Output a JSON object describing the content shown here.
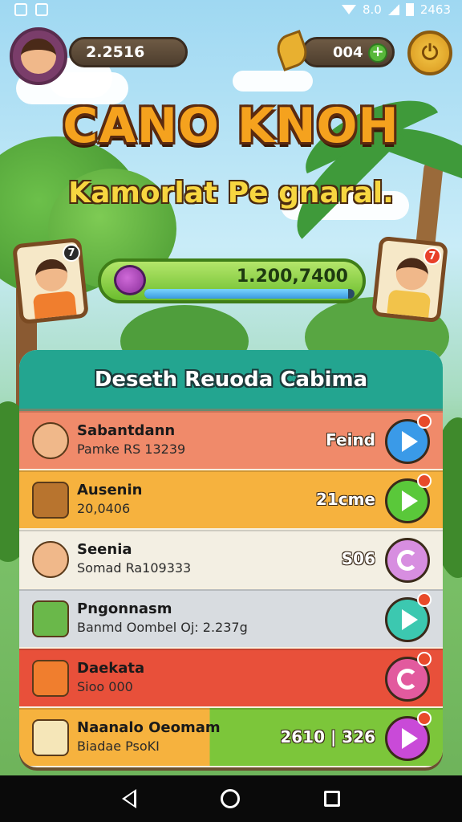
{
  "status_bar": {
    "time": "2463",
    "signal_text": "8.0",
    "icons": [
      "screenshot-icon",
      "gallery-icon",
      "wifi-icon",
      "signal-icon",
      "battery-icon"
    ]
  },
  "header": {
    "coins": "2.2516",
    "gems": "004",
    "plus": "+",
    "power_symbol": "⏻"
  },
  "title": "CANO KNOH",
  "subtitle": "Kamorlat Pe gnaral.",
  "characters": {
    "left_badge": "7",
    "right_badge": "7"
  },
  "xp": {
    "value_text": "1.200,7400",
    "progress": 0.97
  },
  "panel": {
    "title": "Deseth Reuoda Cabima",
    "rows": [
      {
        "name": "Sabantdann",
        "sub": "Pamke RS 13239",
        "right": "Feind",
        "color": "#f08a6a",
        "btn_color": "#3a9ae8",
        "btn": "play"
      },
      {
        "name": "Ausenin",
        "sub": "20,0406",
        "right": "21cme",
        "color": "#f6b23e",
        "btn_color": "#5ac83a",
        "btn": "play"
      },
      {
        "name": "Seenia",
        "sub": "Somad Ra109333",
        "right": "S06",
        "color": "#f3efe3",
        "btn_color": "#d78ee0",
        "btn": "swirl"
      },
      {
        "name": "Pngonnasm",
        "sub": "Banmd Oombel Oj: 2.237g",
        "right": "",
        "color": "#d8dce0",
        "btn_color": "#3cc8b0",
        "btn": "play"
      },
      {
        "name": "Daekata",
        "sub": "Sioo 000",
        "right": "",
        "color": "#e8503a",
        "btn_color": "#e25a9e",
        "btn": "swirl"
      },
      {
        "name": "Naanalo Oeomam",
        "sub": "Biadae PsoKI",
        "right": "2610 | 326",
        "color": "#f6b23e",
        "btn_color": "#c94ad8",
        "btn": "play"
      }
    ]
  }
}
